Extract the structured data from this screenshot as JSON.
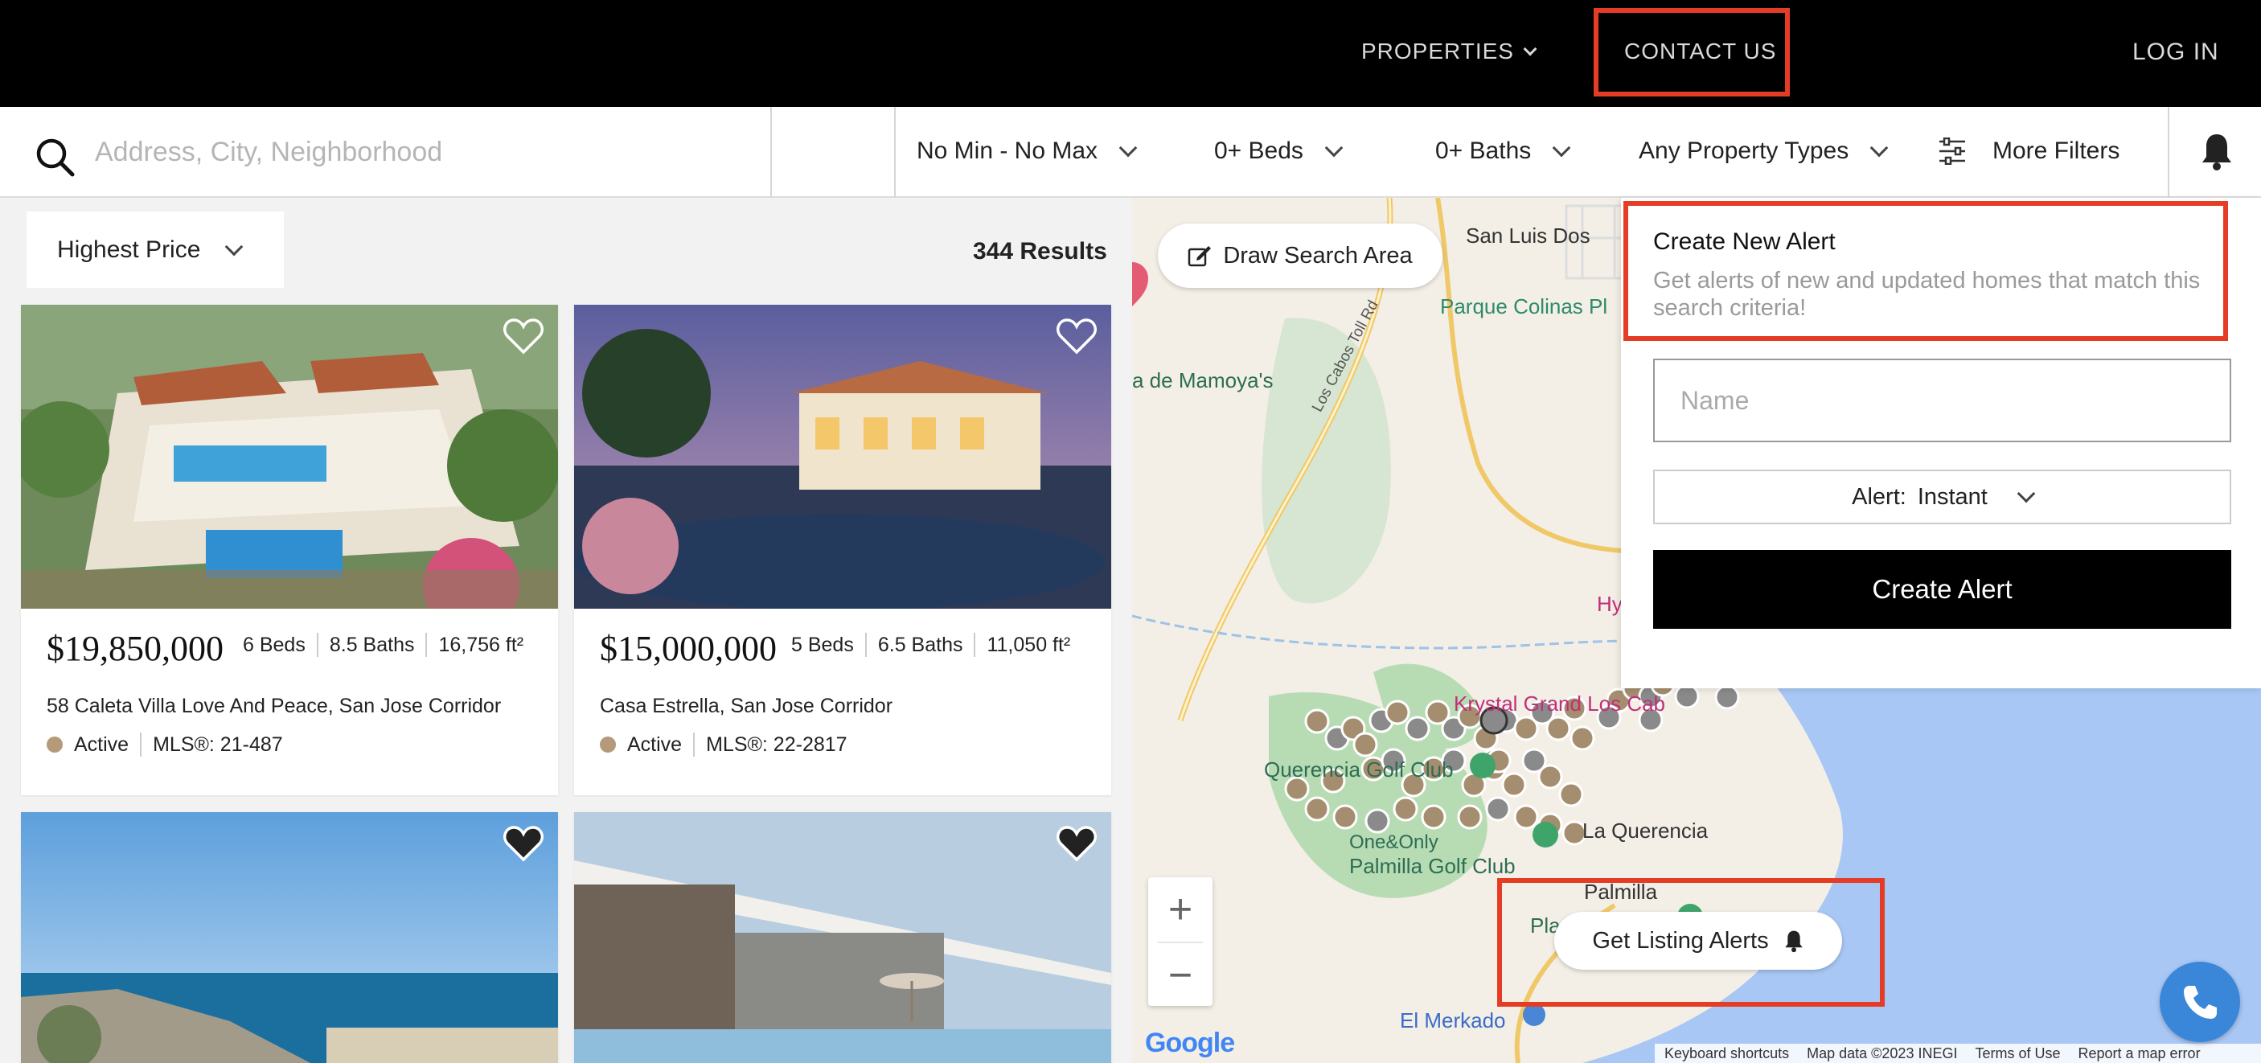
{
  "nav": {
    "properties_label": "PROPERTIES",
    "contact_label": "CONTACT US",
    "login_label": "LOG IN"
  },
  "search": {
    "placeholder": "Address, City, Neighborhood",
    "price_filter": "No Min - No Max",
    "beds_filter": "0+ Beds",
    "baths_filter": "0+ Baths",
    "type_filter": "Any Property Types",
    "more_filters": "More Filters"
  },
  "listing": {
    "sort_label": "Highest Price",
    "results_count": "344 Results",
    "cards": [
      {
        "price": "$19,850,000",
        "beds": "6 Beds",
        "baths": "8.5 Baths",
        "area": "16,756 ft²",
        "address": "58 Caleta Villa Love And Peace, San Jose Corridor",
        "status": "Active",
        "mls": "MLS®: 21-487"
      },
      {
        "price": "$15,000,000",
        "beds": "5 Beds",
        "baths": "6.5 Baths",
        "area": "11,050 ft²",
        "address": "Casa Estrella, San Jose Corridor",
        "status": "Active",
        "mls": "MLS®: 22-2817"
      }
    ]
  },
  "map": {
    "draw_label": "Draw Search Area",
    "alerts_button": "Get Listing Alerts",
    "zoom_in": "+",
    "zoom_out": "−",
    "google": "Google",
    "labels": {
      "san_luis": "San Luis Dos",
      "parque": "Parque Colinas Pl",
      "mamoya": "a de Mamoya's",
      "toll_road": "Los Cabos Toll Rd",
      "krystal": "Krystal Grand Los Cab",
      "querencia_golf": "Querencia Golf Club",
      "la_querencia": "La Querencia",
      "palmilla_golf": "Palmilla Golf Club",
      "palmilla": "Palmilla",
      "one_only": "One&Only",
      "pla": "Pla",
      "el_merkado": "El Merkado",
      "hy": "Hy"
    },
    "footer": [
      "Keyboard shortcuts",
      "Map data ©2023 INEGI",
      "Terms of Use",
      "Report a map error"
    ]
  },
  "alert_panel": {
    "title": "Create New Alert",
    "description": "Get alerts of new and updated homes that match this search criteria!",
    "name_placeholder": "Name",
    "frequency_label": "Alert:",
    "frequency_value": "Instant",
    "create_button": "Create Alert"
  },
  "colors": {
    "highlight": "#e53d25",
    "status_dot": "#b49a78",
    "water": "#a8c7f5",
    "phone": "#3a86d9"
  }
}
